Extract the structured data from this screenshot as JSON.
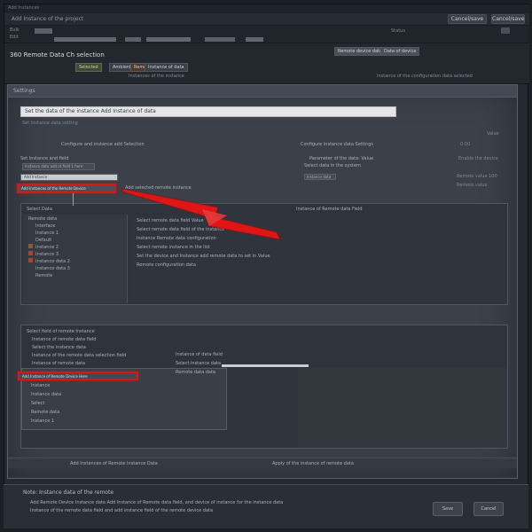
{
  "window": {
    "title": "Add Instances",
    "header_left": "Add Instance of the project",
    "top_buttons": [
      "Cancel/save",
      "Cancel/save"
    ],
    "top_right_icon": "close-icon"
  },
  "menubar": {
    "items": [
      "Bulk",
      "Edit",
      "Status"
    ]
  },
  "ribbon": {
    "items": [
      "ribbon-item",
      "ribbon-item",
      "ribbon-item",
      "ribbon-item",
      "ribbon-item"
    ]
  },
  "infobar": {
    "title": "360 Remote Data  Ch selection",
    "tags": [
      "Selected",
      "Ambient Light",
      "Remote",
      "Instance of data"
    ],
    "subtitle": "Instances of the instance",
    "right_chip": "Remote device data",
    "right_chip_2": "Data of device",
    "right_line": "Instance of the configuration data selected"
  },
  "main": {
    "header": "Settings",
    "setbar_text": "Set the data of the instance Add Instance of data",
    "subline": "Set instance data setting",
    "row1_left": "Configure and instance add Selection",
    "row1_right": "Configure Instance data Settings",
    "row1_num": "0.00",
    "row1_far": "Value",
    "section_a": "Set Instance and field",
    "field_a_label": "Instance data add of field 1 here",
    "field_a_right": "Parameter of the data: Value",
    "field_a_right2": "Select data in the system",
    "field_a_far": "Enable the device",
    "field_a_far2": "Remote value",
    "dropdown_opt": "Add Instance",
    "highlight_field": "Add Instances of the Remote Device",
    "highlight_note": "Add selected remote instance",
    "right_field": "Instance data",
    "right_note": "Remote value 100"
  },
  "panel1": {
    "title": "Select Data",
    "tree": [
      "Remote data",
      "Interface",
      "Instance 1",
      "Default",
      "Instance 2",
      "Instance 3",
      "Instance data 2",
      "Instance data 3",
      "Remote"
    ],
    "header_right": "Instance of Remote data Field",
    "rows": [
      "Select remote data field Value",
      "Select remote data field of the instance",
      "Instance Remote data configuration",
      "Select remote instance in the list",
      "Set the device and Instance add remote data to set in Value",
      "Remote configuration data"
    ]
  },
  "panel2": {
    "title": "Select field of remote Instance",
    "rows": [
      "Instance of remote data field",
      "Select the instance data",
      "Instance of the remote data selection field",
      "Instance of remote data"
    ],
    "highlight": "Add Instance of Remote Device Here",
    "dropdown": [
      "Instance",
      "Instance data",
      "Select",
      "Remote data",
      "Instance 1"
    ],
    "list": [
      "Instance of data field",
      "Select instance data",
      "Remote data data"
    ]
  },
  "main_bottom": {
    "left": "Add Instances of Remote Instance Data",
    "right": "Apply of the instance of remote data"
  },
  "footer": {
    "title": "Note:  Instance data of the remote",
    "line1": "Add Remote Device Instance data Add Instance of Remote data field, and device of instance for the instance data",
    "line2": "Instance of the remote data field and add instance field of the remote device data",
    "buttons": [
      "Save",
      "Cancel"
    ]
  },
  "colors": {
    "annotation_red": "#e01515",
    "background": "#1b1f26",
    "panel": "#3b4049"
  }
}
